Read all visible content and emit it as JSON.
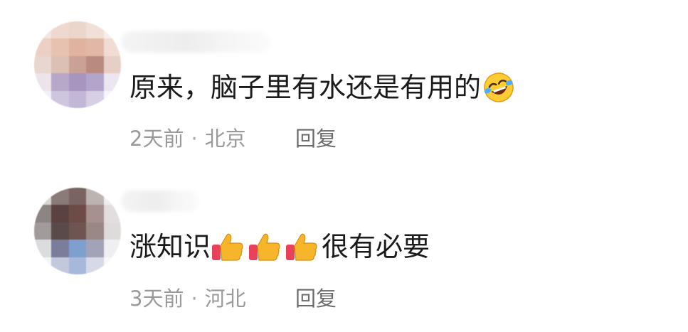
{
  "comments": [
    {
      "text": "原来，脑子里有水还是有用的",
      "emoji": "rolling-on-the-floor-laughing-icon",
      "time": "2天前",
      "location": "北京",
      "separator": "·",
      "reply_label": "回复"
    },
    {
      "text_before": "涨知识",
      "text_after": "很有必要",
      "emoji": "thumbs-up-icon",
      "emoji_count": 3,
      "time": "3天前",
      "location": "河北",
      "separator": "·",
      "reply_label": "回复"
    }
  ],
  "colors": {
    "text": "#1b1b1b",
    "meta": "#9a9a9a",
    "reply": "#6a6a6a",
    "thumb": "#f7b52c",
    "cuff": "#e8415c"
  }
}
